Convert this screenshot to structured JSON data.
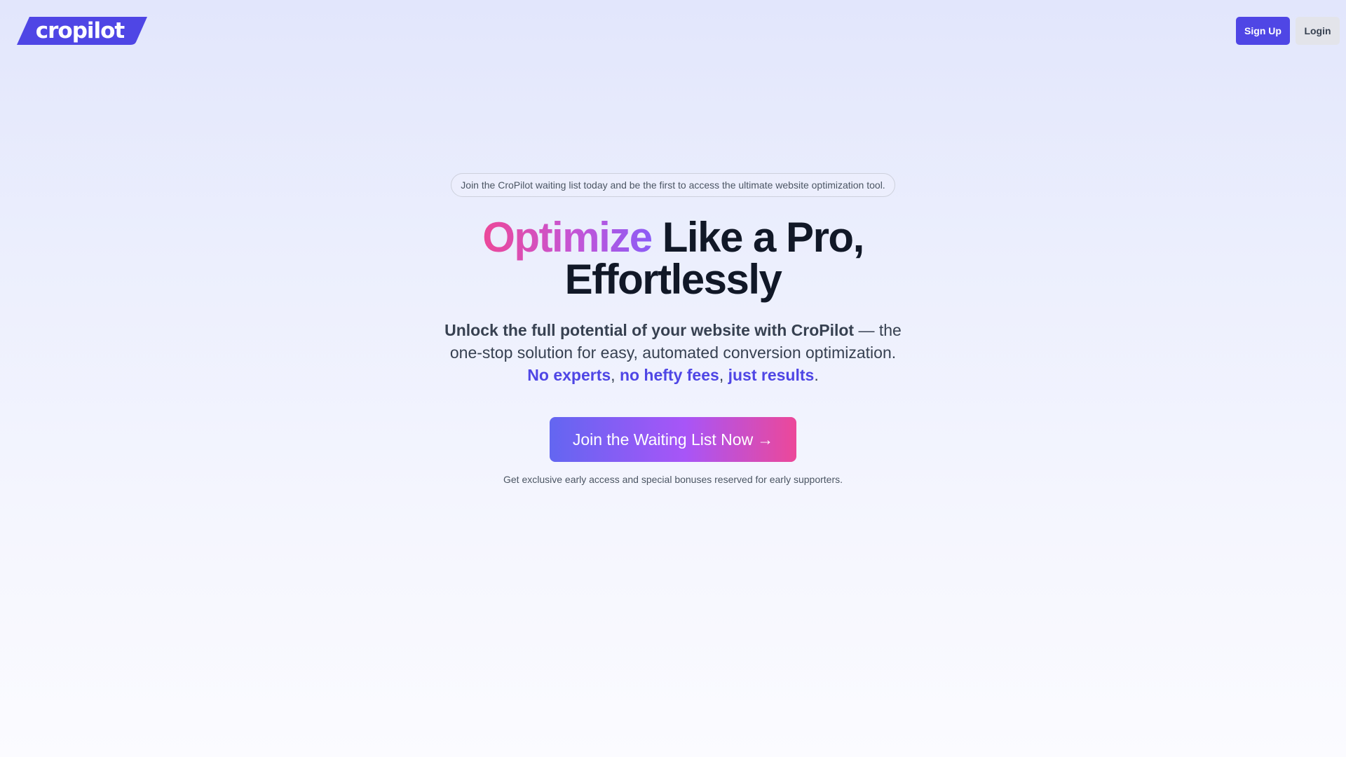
{
  "header": {
    "logo_text": "cropilot",
    "signup_label": "Sign Up",
    "login_label": "Login"
  },
  "hero": {
    "announcement": "Join the CroPilot waiting list today and be the first to access the ultimate website optimization tool.",
    "headline": {
      "highlight": "Optimize",
      "line1_rest": " Like a Pro,",
      "line2": "Effortlessly"
    },
    "subhead": {
      "strong": "Unlock the full potential of your website with CroPilot",
      "rest": " — the one-stop solution for easy, automated conversion optimization.",
      "point1": "No experts",
      "sep1": ", ",
      "point2": "no hefty fees",
      "sep2": ", ",
      "point3": "just results",
      "end": "."
    },
    "cta_label": "Join the Waiting List Now",
    "cta_arrow": "→",
    "cta_note": "Get exclusive early access and special bonuses reserved for early supporters."
  },
  "colors": {
    "brand": "#4f46e5",
    "gradient_start": "#6366f1",
    "gradient_end": "#ec4899",
    "headline_highlight_start": "#ec4899",
    "headline_highlight_end": "#8b5cf6"
  }
}
